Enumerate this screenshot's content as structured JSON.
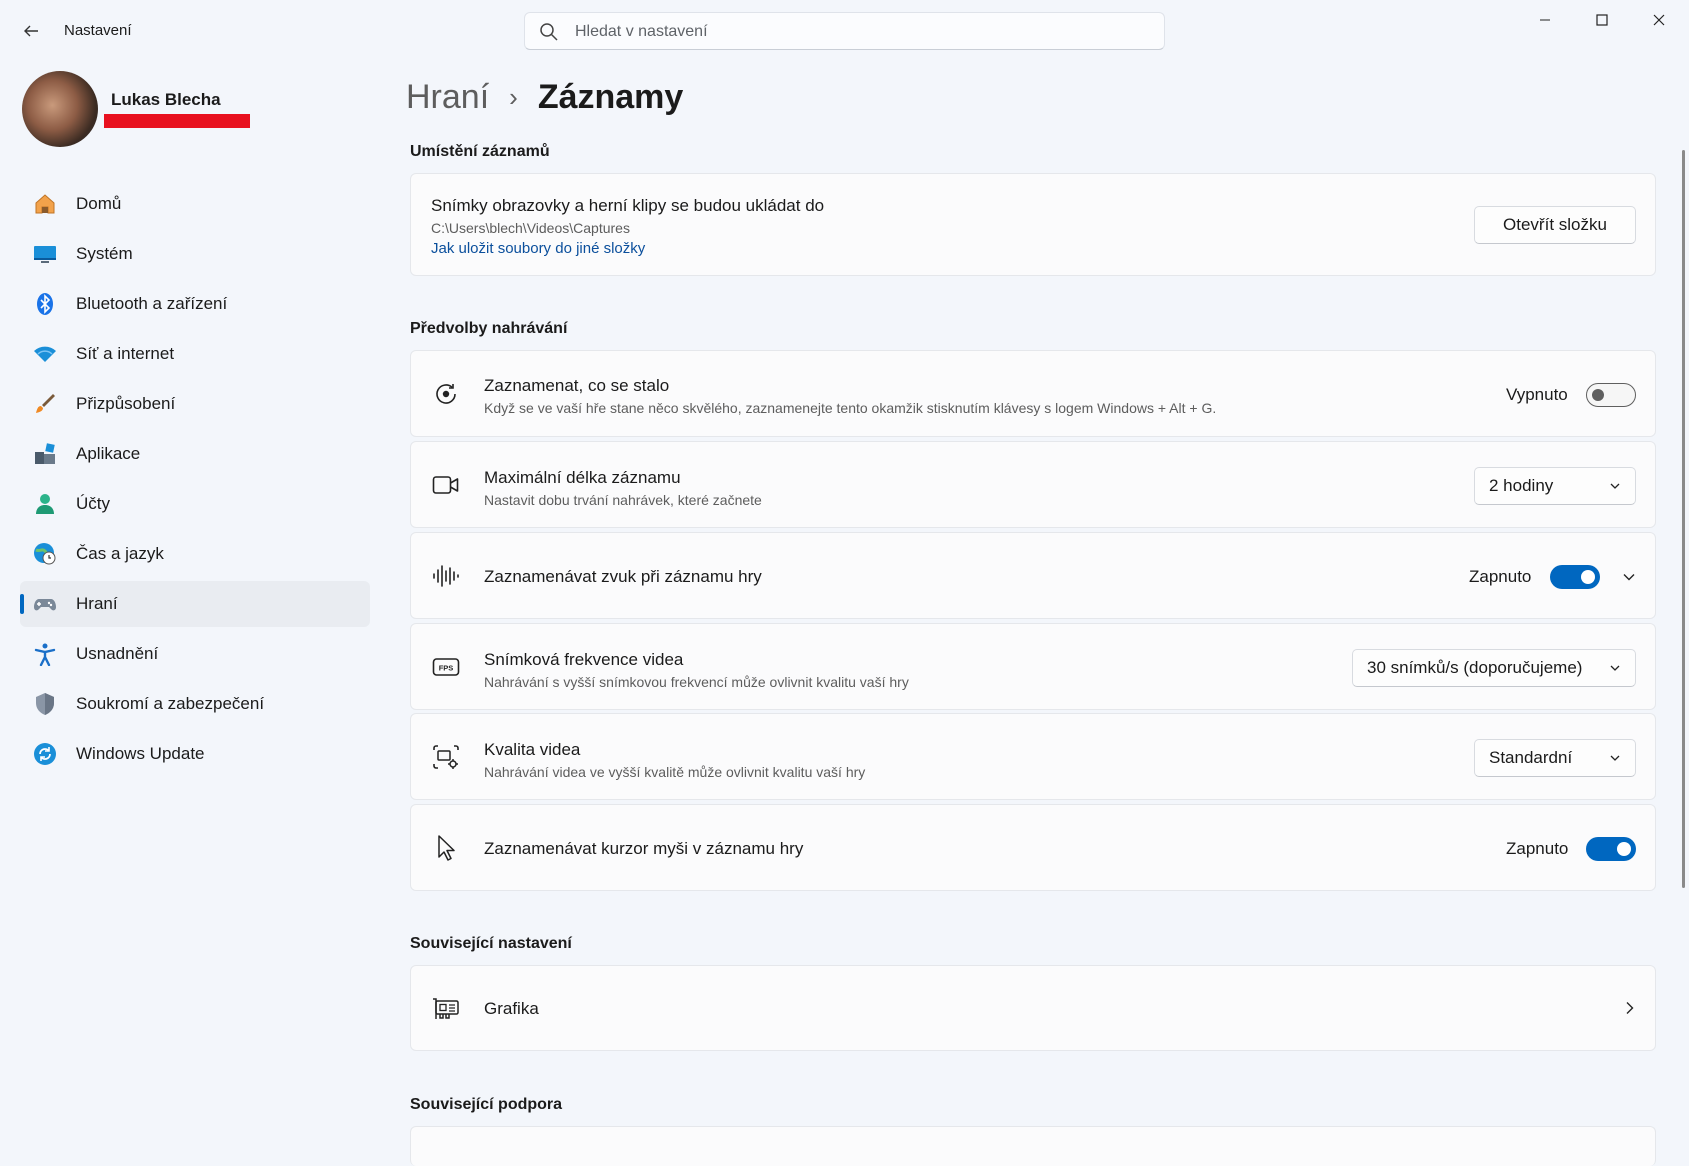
{
  "window": {
    "title": "Nastavení",
    "search_placeholder": "Hledat v nastavení"
  },
  "profile": {
    "name": "Lukas Blecha"
  },
  "nav": {
    "items": [
      {
        "label": "Domů",
        "icon": "home-icon"
      },
      {
        "label": "Systém",
        "icon": "system-icon"
      },
      {
        "label": "Bluetooth a zařízení",
        "icon": "bluetooth-icon"
      },
      {
        "label": "Síť a internet",
        "icon": "wifi-icon"
      },
      {
        "label": "Přizpůsobení",
        "icon": "brush-icon"
      },
      {
        "label": "Aplikace",
        "icon": "apps-icon"
      },
      {
        "label": "Účty",
        "icon": "account-icon"
      },
      {
        "label": "Čas a jazyk",
        "icon": "time-language-icon"
      },
      {
        "label": "Hraní",
        "icon": "gamepad-icon",
        "active": true
      },
      {
        "label": "Usnadnění",
        "icon": "accessibility-icon"
      },
      {
        "label": "Soukromí a zabezpečení",
        "icon": "shield-icon"
      },
      {
        "label": "Windows Update",
        "icon": "update-icon"
      }
    ]
  },
  "breadcrumb": {
    "parent": "Hraní",
    "separator": "›",
    "current": "Záznamy"
  },
  "location": {
    "section_title": "Umístění záznamů",
    "title": "Snímky obrazovky a herní klipy se budou ukládat do",
    "path": "C:\\Users\\blech\\Videos\\Captures",
    "link": "Jak uložit soubory do jiné složky",
    "button": "Otevřít složku"
  },
  "prefs": {
    "section_title": "Předvolby nahrávání",
    "record_what_happened": {
      "title": "Zaznamenat, co se stalo",
      "desc": "Když se ve vaší hře stane něco skvělého, zaznamenejte tento okamžik stisknutím klávesy s logem Windows + Alt + G.",
      "state_label": "Vypnuto",
      "on": false
    },
    "max_length": {
      "title": "Maximální délka záznamu",
      "desc": "Nastavit dobu trvání nahrávek, které začnete",
      "value": "2 hodiny"
    },
    "record_audio": {
      "title": "Zaznamenávat zvuk při záznamu hry",
      "state_label": "Zapnuto",
      "on": true
    },
    "frame_rate": {
      "title": "Snímková frekvence videa",
      "desc": "Nahrávání s vyšší snímkovou frekvencí může ovlivnit kvalitu vaší hry",
      "value": "30 snímků/s (doporučujeme)"
    },
    "video_quality": {
      "title": "Kvalita videa",
      "desc": "Nahrávání videa ve vyšší kvalitě může ovlivnit kvalitu vaší hry",
      "value": "Standardní"
    },
    "record_cursor": {
      "title": "Zaznamenávat kurzor myši v záznamu hry",
      "state_label": "Zapnuto",
      "on": true
    }
  },
  "related_settings": {
    "section_title": "Související nastavení",
    "graphics": "Grafika"
  },
  "related_support": {
    "section_title": "Související podpora"
  },
  "colors": {
    "accent": "#0067c0",
    "background": "#f3f6fb",
    "card": "#fbfbfc",
    "redaction": "#e8111f"
  }
}
